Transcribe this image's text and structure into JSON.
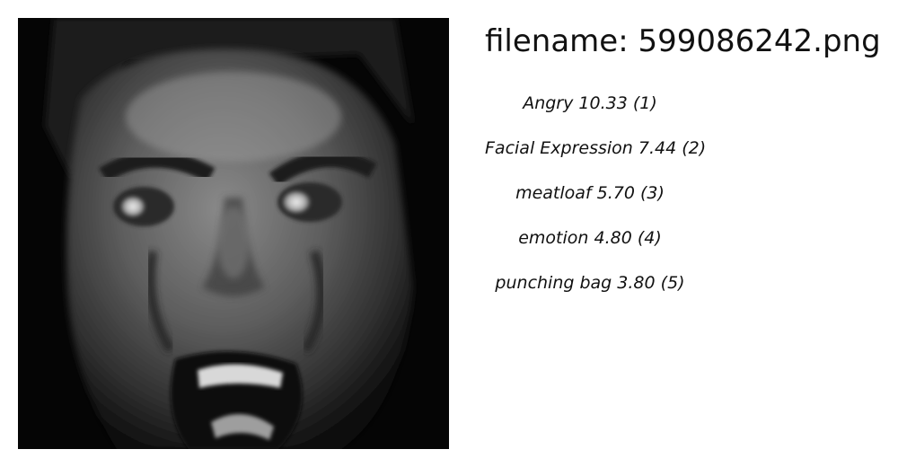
{
  "image": {
    "icon": "face-photo",
    "description_kind": "grayscale close-up photo"
  },
  "filename_label": "filename:",
  "filename": "599086242.png",
  "predictions": [
    {
      "label": "Angry",
      "score": "10.33",
      "rank": "(1)"
    },
    {
      "label": "Facial Expression",
      "score": "7.44",
      "rank": "(2)"
    },
    {
      "label": "meatloaf",
      "score": "5.70",
      "rank": "(3)"
    },
    {
      "label": "emotion",
      "score": "4.80",
      "rank": "(4)"
    },
    {
      "label": "punching bag",
      "score": "3.80",
      "rank": "(5)"
    }
  ]
}
